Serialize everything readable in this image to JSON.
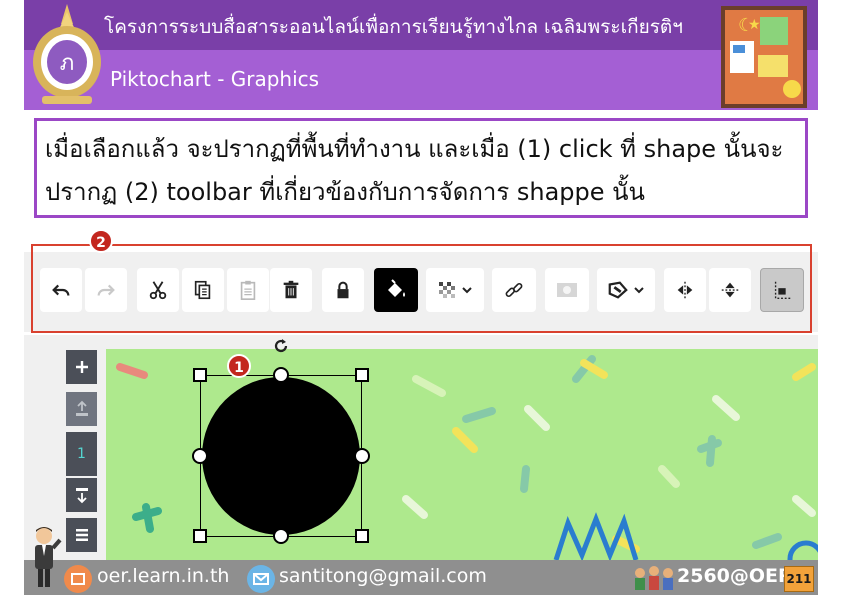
{
  "header": {
    "title": "โครงการระบบสื่อสาระออนไลน์เพื่อการเรียนรู้ทางไกล เฉลิมพระเกียรติฯ",
    "subtitle": "Piktochart - Graphics"
  },
  "description": {
    "line1": "เมื่อเลือกแล้ว จะปรากฏที่พื้นที่ทำงาน และเมื่อ (1) click ที่ shape นั้นจะ",
    "line2": "ปรากฏ (2) toolbar ที่เกี่ยวข้องกับการจัดการ shappe นั้น"
  },
  "markers": {
    "toolbar": "2",
    "shape": "1"
  },
  "toolbar": {
    "buttons": [
      {
        "name": "undo",
        "icon": "undo-icon",
        "enabled": true
      },
      {
        "name": "redo",
        "icon": "redo-icon",
        "enabled": false
      },
      {
        "name": "cut",
        "icon": "scissors-icon",
        "enabled": true
      },
      {
        "name": "copy",
        "icon": "copy-icon",
        "enabled": true
      },
      {
        "name": "paste",
        "icon": "clipboard-icon",
        "enabled": false
      },
      {
        "name": "delete",
        "icon": "trash-icon",
        "enabled": true
      },
      {
        "name": "lock",
        "icon": "lock-icon",
        "enabled": true
      },
      {
        "name": "fill-color",
        "icon": "paint-bucket-icon",
        "enabled": true,
        "active": true
      },
      {
        "name": "transparency",
        "icon": "checkerboard-icon",
        "enabled": true
      },
      {
        "name": "link",
        "icon": "link-icon",
        "enabled": true
      },
      {
        "name": "image-mask",
        "icon": "mask-icon",
        "enabled": false
      },
      {
        "name": "border",
        "icon": "border-icon",
        "enabled": true
      },
      {
        "name": "flip-horizontal",
        "icon": "flip-horizontal-icon",
        "enabled": true
      },
      {
        "name": "flip-vertical",
        "icon": "flip-vertical-icon",
        "enabled": true
      },
      {
        "name": "align",
        "icon": "align-icon",
        "enabled": true,
        "pressed": true
      }
    ]
  },
  "sidebar": {
    "page_number": "1",
    "buttons": [
      "add-block-icon",
      "move-up-icon",
      "move-down-icon",
      "block-menu-icon"
    ]
  },
  "canvas": {
    "background": "#aee98d",
    "shape": "circle",
    "shape_color": "#000000"
  },
  "footer": {
    "website": "oer.learn.in.th",
    "email": "santitong@gmail.com",
    "tag": "2560@OER",
    "page": "211"
  },
  "colors": {
    "header_dark": "#7a3fa8",
    "header_light": "#a45fd4",
    "box_border": "#9b47c6",
    "marker_red": "#c3271f",
    "toolbar_frame": "#d9412f"
  }
}
